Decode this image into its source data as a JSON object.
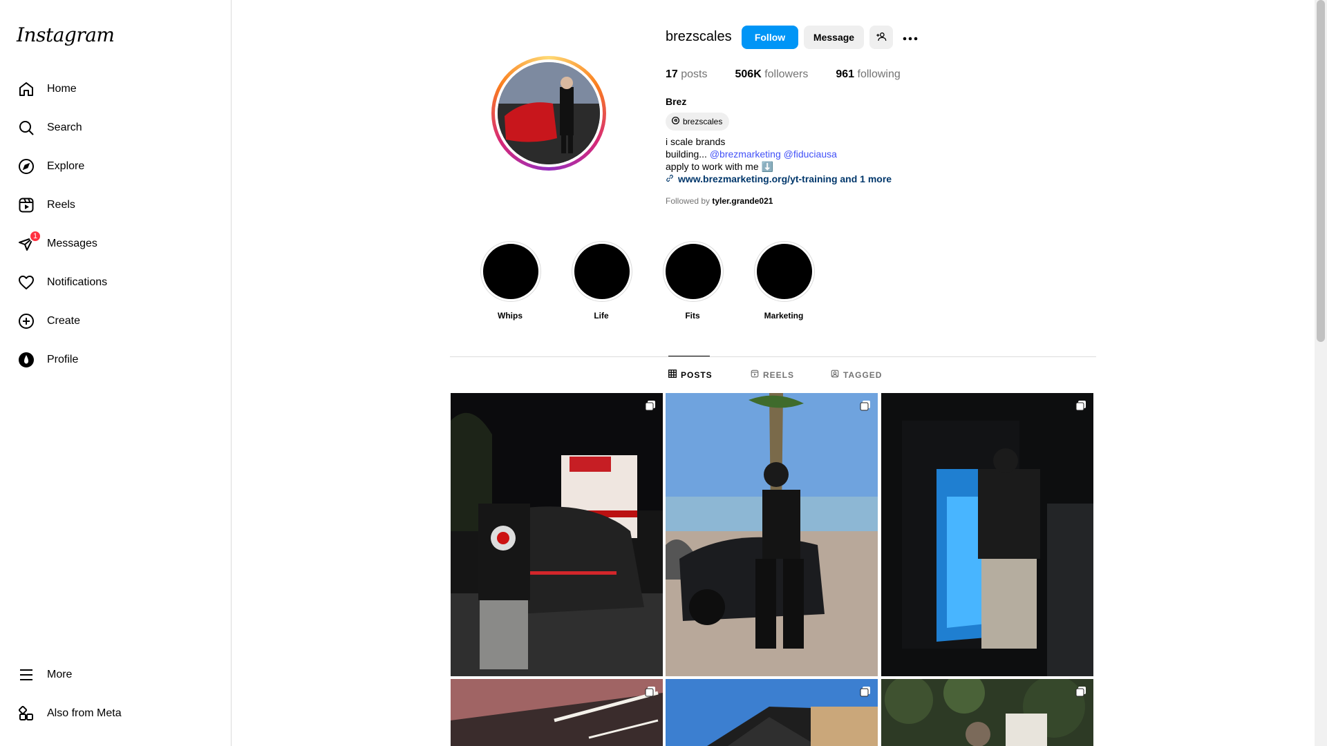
{
  "app": {
    "logo_text": "Instagram"
  },
  "sidebar": {
    "items": [
      {
        "label": "Home",
        "icon": "home-icon"
      },
      {
        "label": "Search",
        "icon": "search-icon"
      },
      {
        "label": "Explore",
        "icon": "explore-icon"
      },
      {
        "label": "Reels",
        "icon": "reels-icon"
      },
      {
        "label": "Messages",
        "icon": "messages-icon",
        "badge": "1"
      },
      {
        "label": "Notifications",
        "icon": "heart-icon"
      },
      {
        "label": "Create",
        "icon": "plus-square-icon"
      },
      {
        "label": "Profile",
        "icon": "profile-avatar-icon"
      }
    ],
    "bottom": [
      {
        "label": "More",
        "icon": "menu-icon"
      },
      {
        "label": "Also from Meta",
        "icon": "meta-apps-icon"
      }
    ]
  },
  "profile": {
    "username": "brezscales",
    "follow_label": "Follow",
    "message_label": "Message",
    "stats": {
      "posts_count": "17",
      "posts_label": "posts",
      "followers_count": "506K",
      "followers_label": "followers",
      "following_count": "961",
      "following_label": "following"
    },
    "full_name": "Brez",
    "threads_handle": "brezscales",
    "bio_line1": "i scale brands",
    "bio_line2_prefix": "building... ",
    "mention1": "@brezmarketing",
    "mention2": "@fiduciausa",
    "bio_line3": "apply to work with me ⬇️",
    "link_text": "www.brezmarketing.org/yt-training and 1 more",
    "followed_by_prefix": "Followed by ",
    "followed_by_user": "tyler.grande021"
  },
  "highlights": [
    {
      "label": "Whips"
    },
    {
      "label": "Life"
    },
    {
      "label": "Fits"
    },
    {
      "label": "Marketing"
    }
  ],
  "tabs": [
    {
      "label": "POSTS",
      "active": true
    },
    {
      "label": "REELS",
      "active": false
    },
    {
      "label": "TAGGED",
      "active": false
    }
  ],
  "colors": {
    "follow_blue": "#0095f6",
    "badge_red": "#ff3040",
    "mention_blue": "#4150f7"
  }
}
